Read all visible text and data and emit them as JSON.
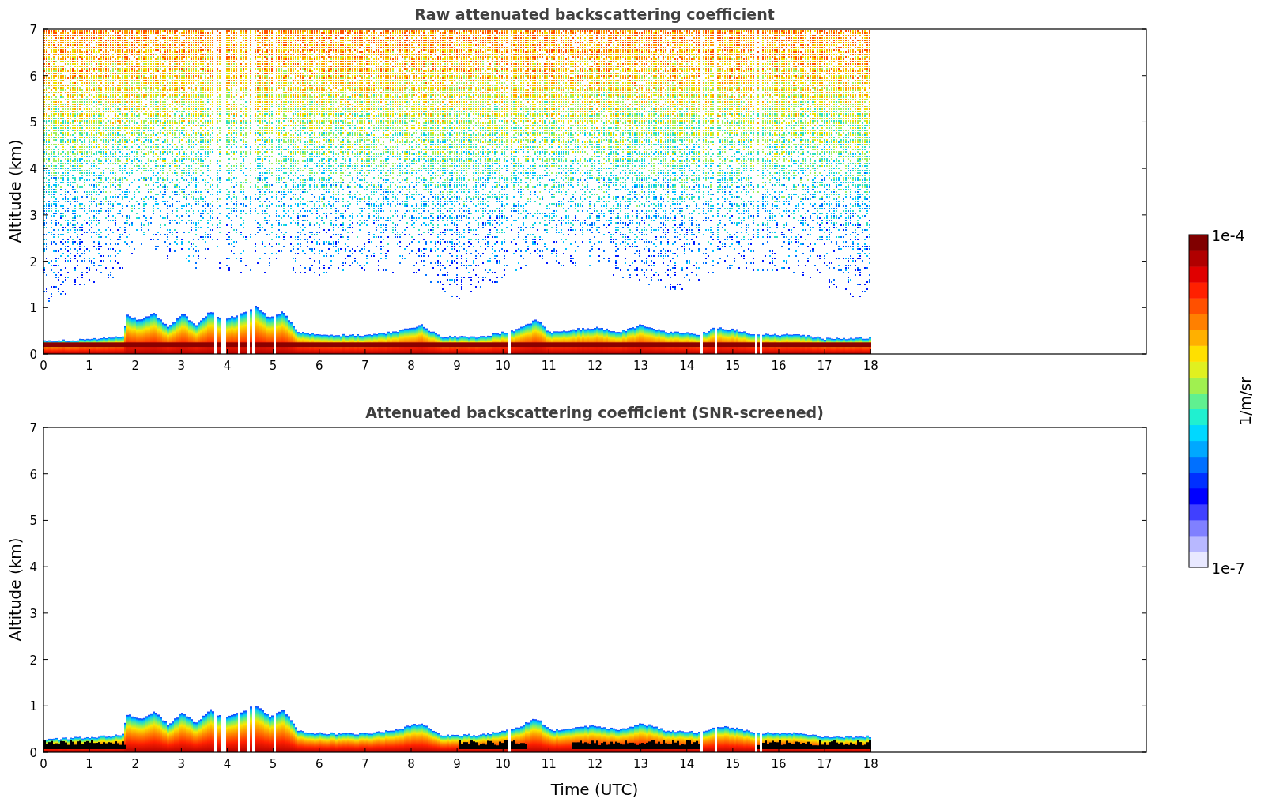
{
  "panels": [
    {
      "kind": "raw",
      "title": "Raw attenuated backscattering coefficient",
      "ylabel": "Altitude (km)",
      "yticks": [
        "7",
        "6",
        "5",
        "4",
        "3",
        "2",
        "1",
        "0"
      ],
      "xticks": [
        "0",
        "1",
        "2",
        "3",
        "4",
        "5",
        "6",
        "7",
        "8",
        "9",
        "10",
        "11",
        "12",
        "13",
        "14",
        "15",
        "16",
        "17",
        "18"
      ]
    },
    {
      "kind": "screened",
      "title": "Attenuated backscattering coefficient (SNR-screened)",
      "ylabel": "Altitude (km)",
      "xlabel": "Time (UTC)",
      "yticks": [
        "7",
        "6",
        "5",
        "4",
        "3",
        "2",
        "1",
        "0"
      ],
      "xticks": [
        "0",
        "1",
        "2",
        "3",
        "4",
        "5",
        "6",
        "7",
        "8",
        "9",
        "10",
        "11",
        "12",
        "13",
        "14",
        "15",
        "16",
        "17",
        "18"
      ]
    }
  ],
  "colorbar": {
    "max_label": "1e-4",
    "min_label": "1e-7",
    "label": "1/m/sr"
  }
}
